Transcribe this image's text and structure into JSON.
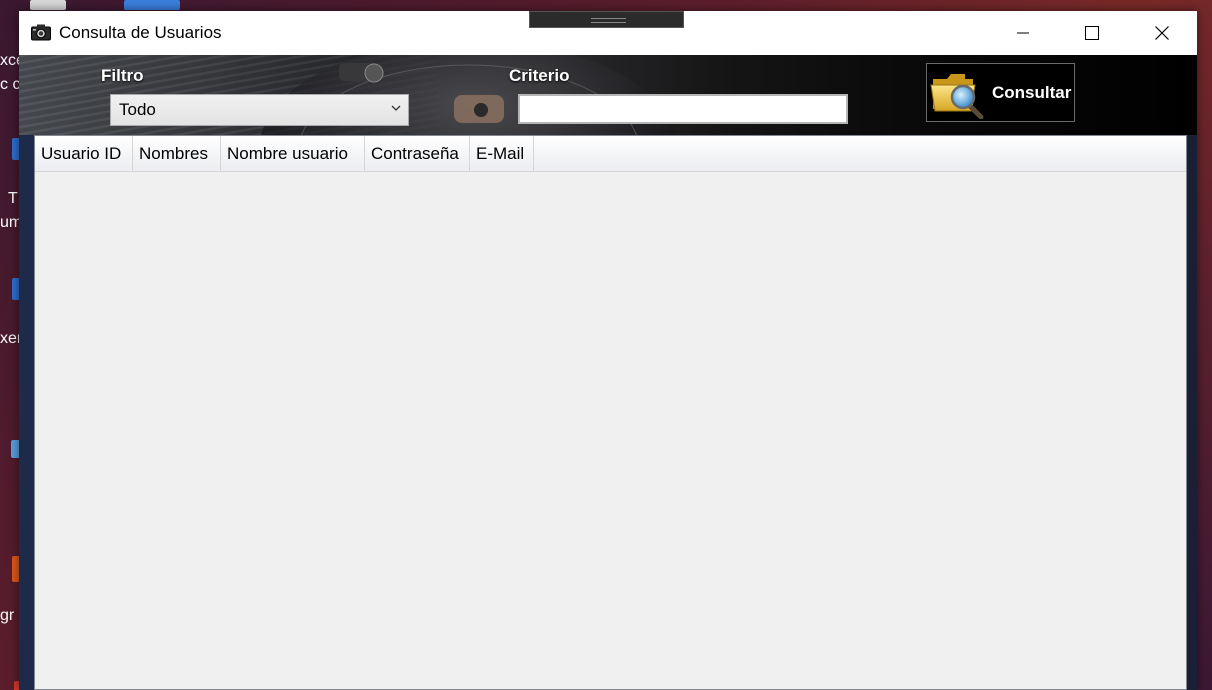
{
  "window": {
    "title": "Consulta de Usuarios"
  },
  "header": {
    "filtro_label": "Filtro",
    "filtro_selected": "Todo",
    "criterio_label": "Criterio",
    "criterio_value": "",
    "consultar_label": "Consultar"
  },
  "grid": {
    "columns": [
      "Usuario ID",
      "Nombres",
      "Nombre usuario",
      "Contraseña",
      "E-Mail"
    ],
    "rows": []
  },
  "desktop": {
    "fragments": [
      "xce",
      "c cl",
      "T",
      "um",
      "xer",
      "gr"
    ]
  },
  "colors": {
    "window_bg": "#ffffff",
    "header_bg": "#000000",
    "grid_bg": "#f0f0f0",
    "desktop_bg": "#5a1d2c"
  }
}
